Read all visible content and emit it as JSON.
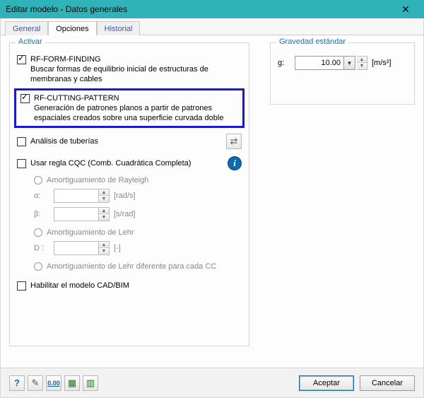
{
  "window": {
    "title": "Editar modelo - Datos generales",
    "close_symbol": "✕"
  },
  "tabs": {
    "general": "General",
    "options": "Opciones",
    "history": "Historial"
  },
  "activate": {
    "title": "Activar",
    "form_finding": {
      "title": "RF-FORM-FINDING",
      "desc": "Buscar formas de equilibrio inicial de estructuras de membranas y cables"
    },
    "cutting_pattern": {
      "title": "RF-CUTTING-PATTERN",
      "desc": "Generación de patrones planos a partir de patrones espaciales creados sobre una superficie curvada doble"
    },
    "pipe_analysis": "Análisis de tuberías",
    "cqc": "Usar regla CQC (Comb. Cuadrática Completa)",
    "rayleigh": "Amortiguamiento de Rayleigh",
    "alpha_label": "α:",
    "alpha_unit": "[rad/s]",
    "beta_label": "β:",
    "beta_unit": "[s/rad]",
    "lehr": "Amortiguamiento de Lehr",
    "d_label": "D :",
    "d_unit": "[-]",
    "lehr_percc": "Amortiguamiento de Lehr diferente para cada CC",
    "enable_cad": "Habilitar el modelo CAD/BIM"
  },
  "gravity": {
    "title": "Gravedad estándar",
    "label": "g:",
    "value": "10.00",
    "unit": "[m/s²]"
  },
  "buttons": {
    "ok": "Aceptar",
    "cancel": "Cancelar"
  },
  "toolbar_icons": {
    "help": "help-icon",
    "note": "note-icon",
    "units": "units-icon",
    "excel_export": "excel-export-icon",
    "excel_import": "excel-import-icon"
  }
}
